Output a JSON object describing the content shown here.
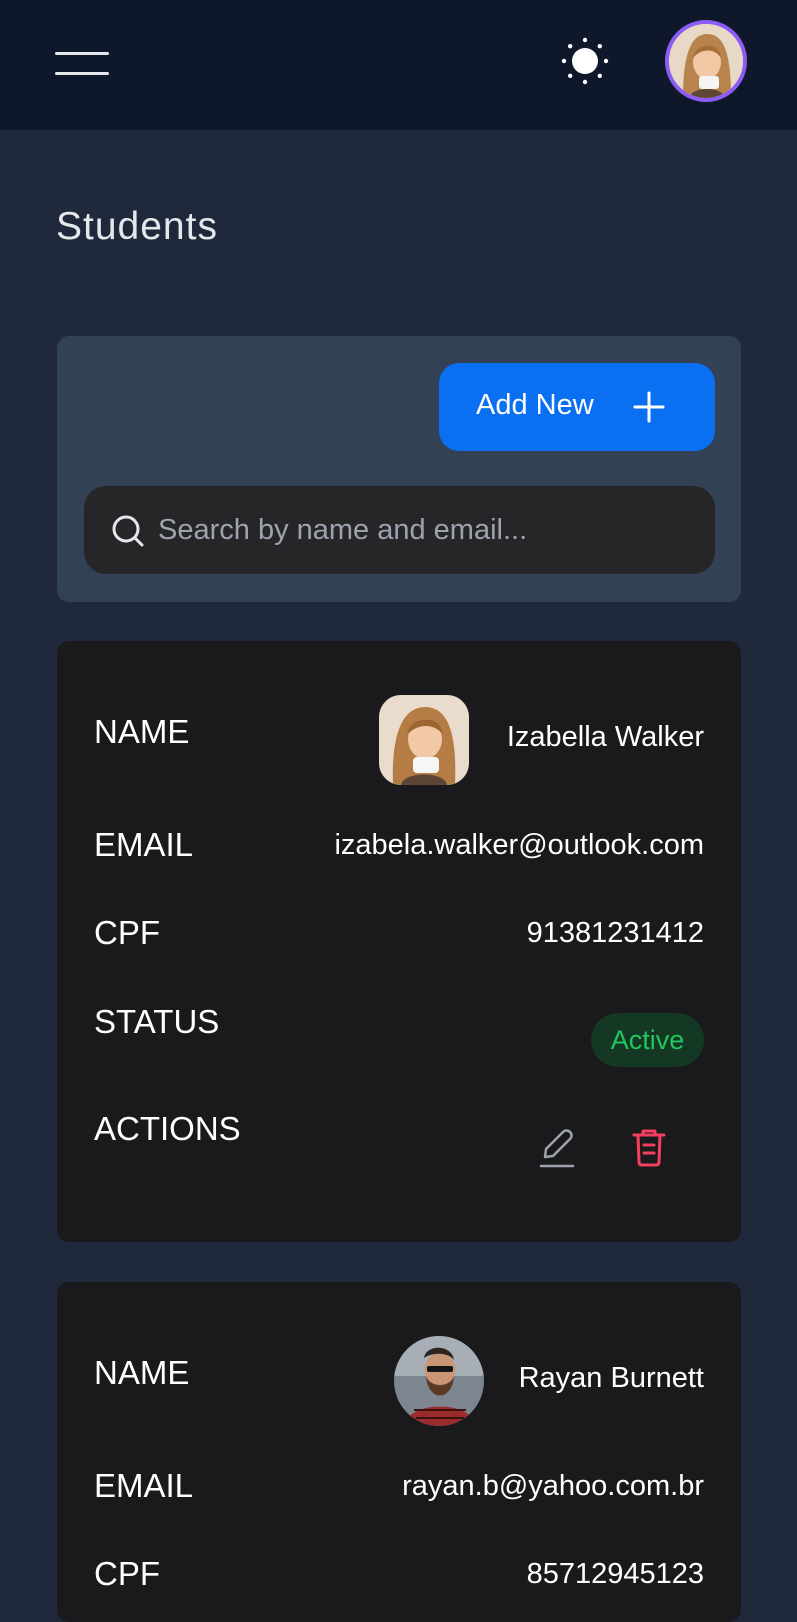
{
  "header": {
    "menu_icon": "hamburger-menu-icon",
    "theme_icon": "sun-icon",
    "avatar": "user-avatar",
    "accent": "#8b5cf6"
  },
  "page": {
    "title": "Students"
  },
  "toolbar": {
    "add_label": "Add New",
    "add_icon": "plus-icon",
    "search_placeholder": "Search by name and email...",
    "search_icon": "search-icon",
    "primary_color": "#0a6ff0"
  },
  "labels": {
    "name": "NAME",
    "email": "EMAIL",
    "cpf": "CPF",
    "status": "STATUS",
    "actions": "ACTIONS"
  },
  "students": [
    {
      "name": "Izabella Walker",
      "email": "izabela.walker@outlook.com",
      "cpf": "91381231412",
      "status": "Active",
      "status_color": "#22c55e",
      "edit_icon": "pencil-icon",
      "delete_icon": "trash-icon"
    },
    {
      "name": "Rayan Burnett",
      "email": "rayan.b@yahoo.com.br",
      "cpf": "85712945123"
    }
  ]
}
